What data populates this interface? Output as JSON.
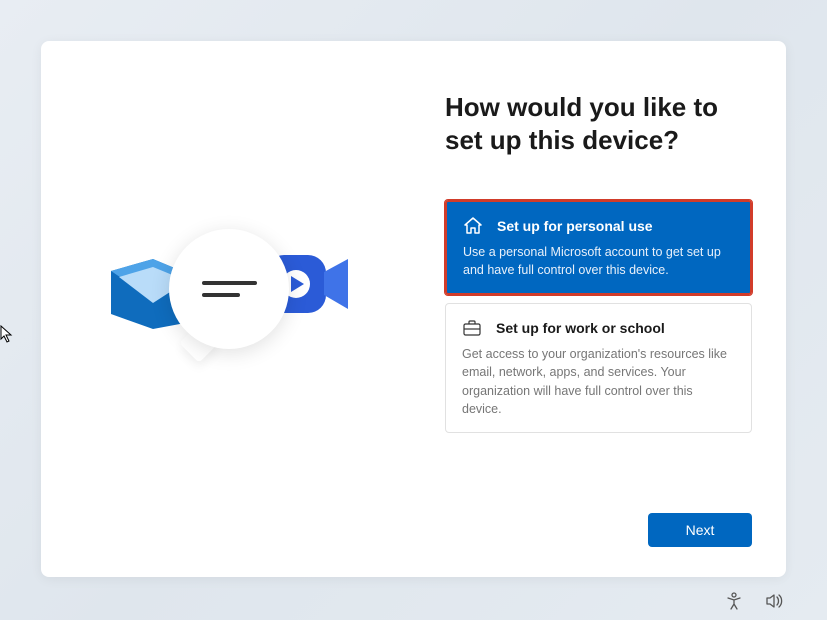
{
  "heading": "How would you like to set up this device?",
  "options": {
    "personal": {
      "title": "Set up for personal use",
      "desc": "Use a personal Microsoft account to get set up and have full control over this device."
    },
    "work": {
      "title": "Set up for work or school",
      "desc": "Get access to your organization's resources like email, network, apps, and services. Your organization will have full control over this device."
    }
  },
  "buttons": {
    "next": "Next"
  }
}
